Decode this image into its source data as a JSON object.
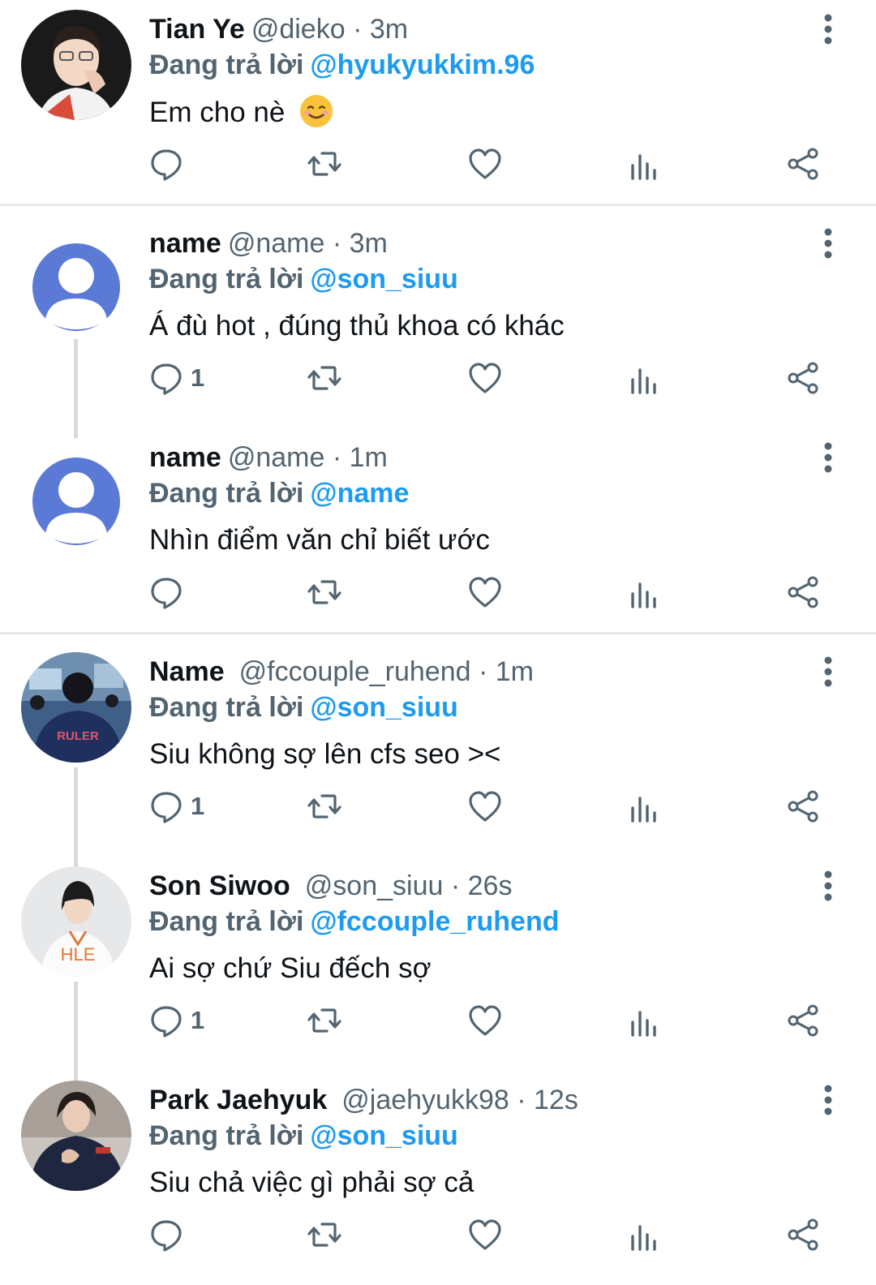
{
  "colors": {
    "accent": "#1d9bf0",
    "muted": "#536471",
    "text": "#0f1419",
    "divider": "#e7e9ea",
    "thread": "#d6dbe0"
  },
  "tweets": [
    {
      "name": "Tian Ye",
      "handle": "@dieko",
      "time": "3m",
      "reply_prefix": "Đang trả lời",
      "reply_to": "@hyukyukkim.96",
      "text": "Em cho nè",
      "emoji": "smiling-face-emoji",
      "avatar": "photo-avatar",
      "reply_count": ""
    },
    {
      "name": "name",
      "handle": "@name",
      "time": "3m",
      "reply_prefix": "Đang trả lời",
      "reply_to": "@son_siuu",
      "text": "Á đù hot , đúng thủ khoa có khác",
      "avatar": "default-avatar",
      "reply_count": "1"
    },
    {
      "name": "name",
      "handle": "@name",
      "time": "1m",
      "reply_prefix": "Đang trả lời",
      "reply_to": "@name",
      "text": "Nhìn điểm văn chỉ biết ước",
      "avatar": "default-avatar",
      "reply_count": ""
    },
    {
      "name": "Name",
      "handle": "@fccouple_ruhend",
      "time": "1m",
      "reply_prefix": "Đang trả lời",
      "reply_to": "@son_siuu",
      "text": "Siu không sợ lên cfs seo ><",
      "avatar": "photo-avatar-ruler",
      "avatar_label": "RULER",
      "reply_count": "1"
    },
    {
      "name": "Son Siwoo",
      "handle": "@son_siuu",
      "time": "26s",
      "reply_prefix": "Đang trả lời",
      "reply_to": "@fccouple_ruhend",
      "text": "Ai sợ chứ Siu đếch sợ",
      "avatar": "photo-avatar-hle",
      "avatar_label": "HLE",
      "reply_count": "1"
    },
    {
      "name": "Park Jaehyuk",
      "handle": "@jaehyukk98",
      "time": "12s",
      "reply_prefix": "Đang trả lời",
      "reply_to": "@son_siuu",
      "text": "Siu chả việc gì phải sợ cả",
      "avatar": "photo-avatar",
      "reply_count": ""
    }
  ],
  "icons": [
    "reply-icon",
    "retweet-icon",
    "like-icon",
    "views-icon",
    "share-icon",
    "more-icon"
  ]
}
